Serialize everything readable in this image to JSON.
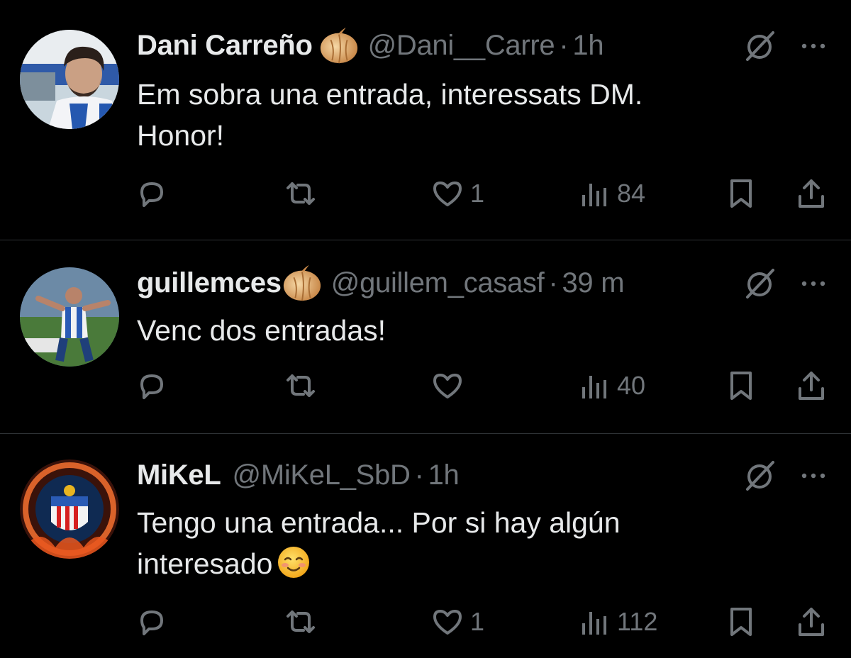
{
  "colors": {
    "background": "#000000",
    "text": "#e7e9ea",
    "secondary": "#71767b",
    "divider": "#2f3336"
  },
  "icons": {
    "reply": "reply-bubble-icon",
    "retweet": "retweet-icon",
    "like": "heart-icon",
    "views": "views-bar-chart-icon",
    "bookmark": "bookmark-icon",
    "share": "share-upload-icon",
    "grok": "grok-slash-circle-icon",
    "more": "more-dots-icon",
    "onion": "onion-emoji-icon"
  },
  "tweets": [
    {
      "name": "Dani Carreño",
      "handle": "@Dani__Carre",
      "separator": "·",
      "time": "1h",
      "text_lines": [
        "Em sobra una entrada, interessats DM.",
        "Honor!"
      ],
      "likes": "1",
      "views": "84"
    },
    {
      "name": "guillemces",
      "handle": "@guillem_casasf",
      "separator": "·",
      "time": "39 m",
      "text_lines": [
        "Venc dos entradas!"
      ],
      "likes": "",
      "views": "40"
    },
    {
      "name": "MiKeL",
      "handle": "@MiKeL_SbD",
      "separator": "·",
      "time": "1h",
      "text_lines": [
        "Tengo una entrada... Por si hay algún",
        "interesado"
      ],
      "likes": "1",
      "views": "112"
    }
  ]
}
